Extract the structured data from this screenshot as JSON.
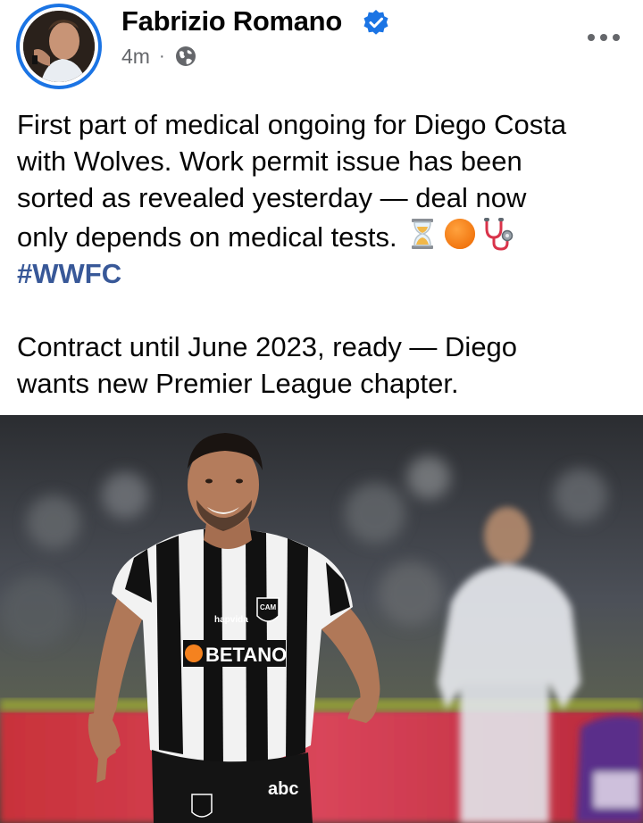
{
  "post": {
    "author": "Fabrizio Romano",
    "verified": true,
    "time": "4m",
    "separator": "·",
    "privacy_icon": "globe-icon",
    "more_icon": "more-horizontal-icon",
    "text_lines": [
      "First part of medical ongoing for Diego Costa",
      "with Wolves. Work permit issue has been",
      "sorted as revealed yesterday — deal now",
      "only depends on medical tests."
    ],
    "emojis": [
      "hourglass-icon",
      "orange-circle-icon",
      "stethoscope-icon"
    ],
    "hashtag": "#WWFC",
    "text_lines_2": [
      "Contract until June 2023, ready — Diego",
      "wants new Premier League chapter."
    ],
    "photo": {
      "description_icon": "football-player-photo",
      "shirt_sponsor": "BETANO",
      "sleeve_sponsor": "hapvida",
      "crest": "CAM",
      "shorts_sponsor": "abc"
    }
  },
  "colors": {
    "link": "#385898",
    "ring": "#1b74e4",
    "meta": "#65676b",
    "text": "#050505"
  }
}
